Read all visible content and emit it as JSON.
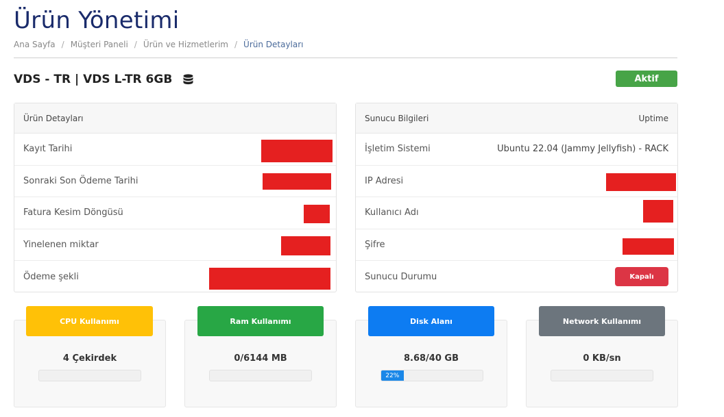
{
  "page": {
    "title": "Ürün Yönetimi",
    "breadcrumb": [
      "Ana Sayfa",
      "Müşteri Paneli",
      "Ürün ve Hizmetlerim",
      "Ürün Detayları"
    ]
  },
  "product": {
    "name": "VDS - TR | VDS L-TR 6GB",
    "icon": "database-icon",
    "status": "Aktif",
    "status_color": "#47a447"
  },
  "details": {
    "header": "Ürün Detayları",
    "rows": [
      {
        "label": "Kayıt Tarihi"
      },
      {
        "label": "Sonraki Son Ödeme Tarihi"
      },
      {
        "label": "Fatura Kesim Döngüsü"
      },
      {
        "label": "Yinelenen miktar"
      },
      {
        "label": "Ödeme şekli"
      }
    ]
  },
  "server": {
    "header": "Sunucu Bilgileri",
    "header_right": "Uptime",
    "rows": [
      {
        "label": "İşletim Sistemi",
        "value": "Ubuntu 22.04 (Jammy Jellyfish) - RACK"
      },
      {
        "label": "IP Adresi"
      },
      {
        "label": "Kullanıcı Adı"
      },
      {
        "label": "Şifre"
      },
      {
        "label": "Sunucu Durumu",
        "value": "Kapalı"
      }
    ]
  },
  "stats": [
    {
      "title": "CPU Kullanımı",
      "value": "4 Çekirdek",
      "color": "#ffc107",
      "fraction": 0
    },
    {
      "title": "Ram Kullanımı",
      "value": "0/6144 MB",
      "color": "#28a745",
      "fraction": 0
    },
    {
      "title": "Disk Alanı",
      "value": "8.68/40 GB",
      "color": "#0d7cf2",
      "fraction": 0.22,
      "bar_label": "22%"
    },
    {
      "title": "Network Kullanımı",
      "value": "0 KB/sn",
      "color": "#6c757d",
      "fraction": 0
    }
  ],
  "colors": {
    "title": "#1a2b6b",
    "redaction": "#e52020",
    "danger": "#dc3545"
  }
}
